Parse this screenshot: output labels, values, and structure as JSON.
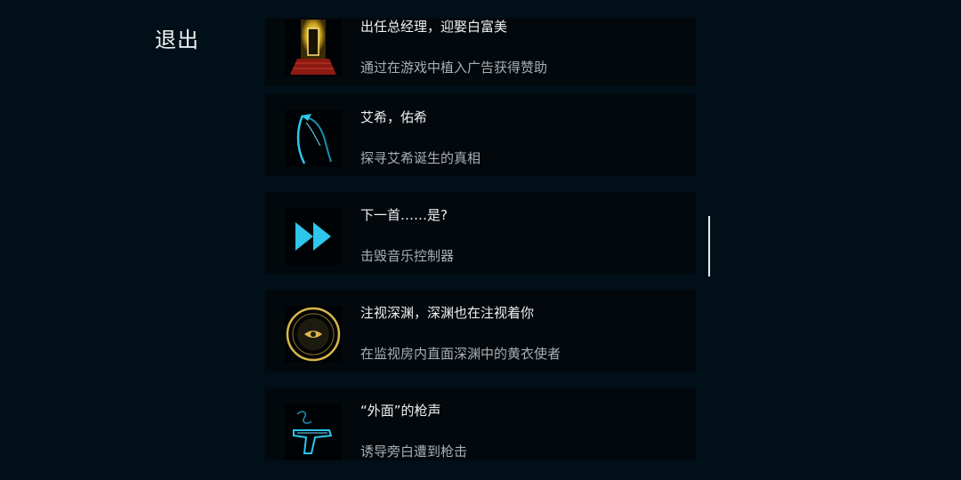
{
  "exit_label": "退出",
  "achievements": [
    {
      "icon": "golden-door-stairs-icon",
      "title": "出任总经理，迎娶白富美",
      "description": "通过在游戏中植入广告获得赞助"
    },
    {
      "icon": "scythe-icon",
      "title": "艾希，佑希",
      "description": "探寻艾希诞生的真相"
    },
    {
      "icon": "fast-forward-icon",
      "title": "下一首……是?",
      "description": "击毁音乐控制器"
    },
    {
      "icon": "eye-emblem-icon",
      "title": "注视深渊，深渊也在注视着你",
      "description": "在监视房内直面深渊中的黄衣使者"
    },
    {
      "icon": "pistol-icon",
      "title": "“外面”的枪声",
      "description": "诱导旁白遭到枪击"
    }
  ],
  "colors": {
    "background": "#000f18",
    "card": "#02080c",
    "accent_cyan": "#2ec6ea",
    "accent_gold": "#d9b84a"
  }
}
